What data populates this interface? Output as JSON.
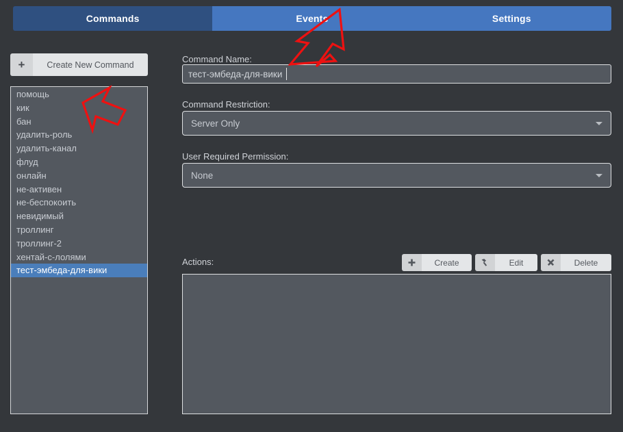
{
  "tabs": [
    {
      "label": "Commands",
      "selected": true
    },
    {
      "label": "Events",
      "selected": false
    },
    {
      "label": "Settings",
      "selected": false
    }
  ],
  "sidebar": {
    "create_button": {
      "icon": "plus-icon",
      "icon_glyph": "+",
      "label": "Create New Command"
    },
    "commands": [
      {
        "label": "помощь",
        "selected": false
      },
      {
        "label": "кик",
        "selected": false
      },
      {
        "label": "бан",
        "selected": false
      },
      {
        "label": "удалить-роль",
        "selected": false
      },
      {
        "label": "удалить-канал",
        "selected": false
      },
      {
        "label": "флуд",
        "selected": false
      },
      {
        "label": "онлайн",
        "selected": false
      },
      {
        "label": "не-активен",
        "selected": false
      },
      {
        "label": "не-беспокоить",
        "selected": false
      },
      {
        "label": "невидимый",
        "selected": false
      },
      {
        "label": "троллинг",
        "selected": false
      },
      {
        "label": "троллинг-2",
        "selected": false
      },
      {
        "label": "хентай-с-лолями",
        "selected": false
      },
      {
        "label": "тест-эмбеда-для-вики",
        "selected": true
      }
    ]
  },
  "form": {
    "command_name": {
      "label": "Command Name:",
      "value": "тест-эмбеда-для-вики",
      "placeholder": ""
    },
    "command_restriction": {
      "label": "Command Restriction:",
      "value": "Server Only",
      "arrow_icon": "chevron-down-icon"
    },
    "user_required_permission": {
      "label": "User Required Permission:",
      "value": "None",
      "arrow_icon": "chevron-down-icon"
    },
    "actions": {
      "label": "Actions:",
      "buttons": [
        {
          "label": "Create",
          "icon": "plus-icon",
          "icon_glyph": "✚"
        },
        {
          "label": "Edit",
          "icon": "hammer-icon",
          "icon_glyph": "🔨"
        },
        {
          "label": "Delete",
          "icon": "close-x-icon",
          "icon_glyph": "✖"
        }
      ],
      "items": []
    }
  },
  "colors": {
    "background": "#34373b",
    "panel": "#53585f",
    "tab_selected": "#2f5080",
    "tab_unselected": "#4577c0",
    "list_selected": "#4a7ebb",
    "button_face": "#e4e6e8",
    "button_icon_face": "#d1d3d5",
    "border": "#dfe1e3",
    "text": "#c9cdd3",
    "annotation": "#ee1111"
  },
  "annotations": [
    {
      "name": "arrow-to-command-name-field",
      "color": "#ee1111"
    },
    {
      "name": "arrow-to-command-list",
      "color": "#ee1111"
    }
  ]
}
